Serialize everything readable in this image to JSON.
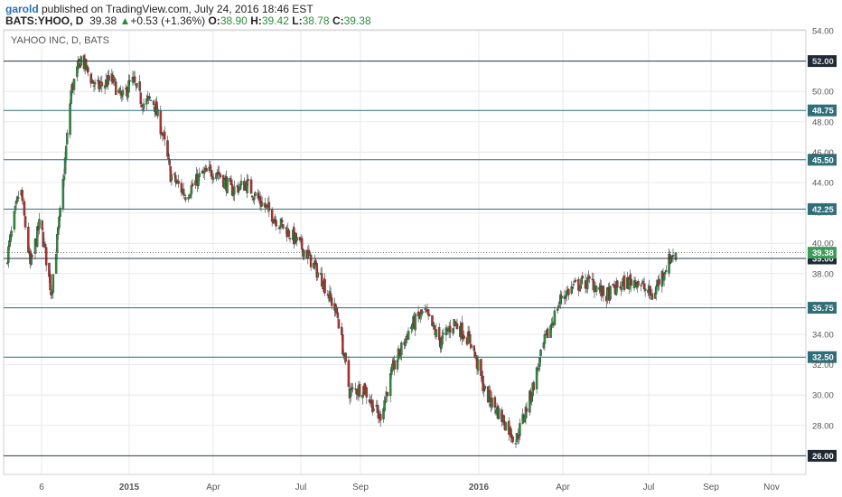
{
  "header": {
    "author": "garold",
    "published": " published on TradingView.com, July 24, 2016 18:46 EST",
    "symbol": "BATS:YHOO, D",
    "last": "39.38",
    "change_arrow": "▲",
    "change": "+0.53 (+1.36%)",
    "o_label": "O:",
    "o_value": "38.90",
    "h_label": "H:",
    "h_value": "39.42",
    "l_label": "L:",
    "l_value": "38.78",
    "c_label": "C:",
    "c_value": "39.38"
  },
  "colors": {
    "up": "#2e8b3d",
    "down": "#b0312c",
    "level_line": "#2f6e78",
    "level_box": "#2f6e78",
    "highlight_box": "#1f2a36",
    "price_box": "#3e9c5a",
    "grid": "#e8e8e8"
  },
  "chart_data": {
    "type": "candlestick",
    "title": "YAHOO INC, D, BATS",
    "ylim": [
      25.2,
      54.2
    ],
    "y_ticks": [
      "54.00",
      "52.00",
      "50.00",
      "48.00",
      "46.00",
      "44.00",
      "42.00",
      "40.00",
      "38.00",
      "36.00",
      "34.00",
      "32.00",
      "30.00",
      "28.00"
    ],
    "x_labels": [
      "6",
      "2015",
      "Apr",
      "Jul",
      "Sep",
      "2016",
      "Apr",
      "Jul",
      "Sep",
      "Nov"
    ],
    "levels": [
      "52.00",
      "48.75",
      "45.50",
      "42.25",
      "39.00",
      "35.75",
      "32.50",
      "26.00"
    ],
    "current_price": "39.38",
    "path": [
      [
        "2014-09-20",
        38.5
      ],
      [
        "2014-10-05",
        43.8
      ],
      [
        "2014-10-15",
        38.5
      ],
      [
        "2014-10-25",
        41.5
      ],
      [
        "2014-11-05",
        36.8
      ],
      [
        "2014-11-15",
        42.5
      ],
      [
        "2014-11-25",
        50.0
      ],
      [
        "2014-12-05",
        52.2
      ],
      [
        "2014-12-20",
        50.2
      ],
      [
        "2015-01-05",
        50.8
      ],
      [
        "2015-01-15",
        49.5
      ],
      [
        "2015-01-25",
        50.8
      ],
      [
        "2015-02-05",
        49.2
      ],
      [
        "2015-02-15",
        49.5
      ],
      [
        "2015-02-25",
        47.2
      ],
      [
        "2015-03-05",
        44.5
      ],
      [
        "2015-03-20",
        43.2
      ],
      [
        "2015-04-05",
        44.5
      ],
      [
        "2015-04-20",
        44.8
      ],
      [
        "2015-05-05",
        43.5
      ],
      [
        "2015-05-20",
        43.9
      ],
      [
        "2015-06-05",
        42.6
      ],
      [
        "2015-06-20",
        41.5
      ],
      [
        "2015-07-05",
        40.5
      ],
      [
        "2015-07-20",
        39.3
      ],
      [
        "2015-08-05",
        37.5
      ],
      [
        "2015-08-20",
        35.2
      ],
      [
        "2015-09-01",
        30.2
      ],
      [
        "2015-09-15",
        30.5
      ],
      [
        "2015-10-01",
        28.5
      ],
      [
        "2015-10-15",
        31.8
      ],
      [
        "2015-11-01",
        34.5
      ],
      [
        "2015-11-15",
        35.5
      ],
      [
        "2015-12-01",
        33.5
      ],
      [
        "2015-12-15",
        34.8
      ],
      [
        "2016-01-01",
        33.5
      ],
      [
        "2016-01-15",
        30.2
      ],
      [
        "2016-02-01",
        28.5
      ],
      [
        "2016-02-15",
        27.0
      ],
      [
        "2016-03-01",
        30.0
      ],
      [
        "2016-03-15",
        33.5
      ],
      [
        "2016-04-01",
        36.5
      ],
      [
        "2016-04-15",
        37.2
      ],
      [
        "2016-05-01",
        37.5
      ],
      [
        "2016-05-15",
        36.5
      ],
      [
        "2016-06-01",
        37.3
      ],
      [
        "2016-06-15",
        37.6
      ],
      [
        "2016-07-01",
        36.5
      ],
      [
        "2016-07-10",
        37.8
      ],
      [
        "2016-07-22",
        39.4
      ]
    ]
  }
}
